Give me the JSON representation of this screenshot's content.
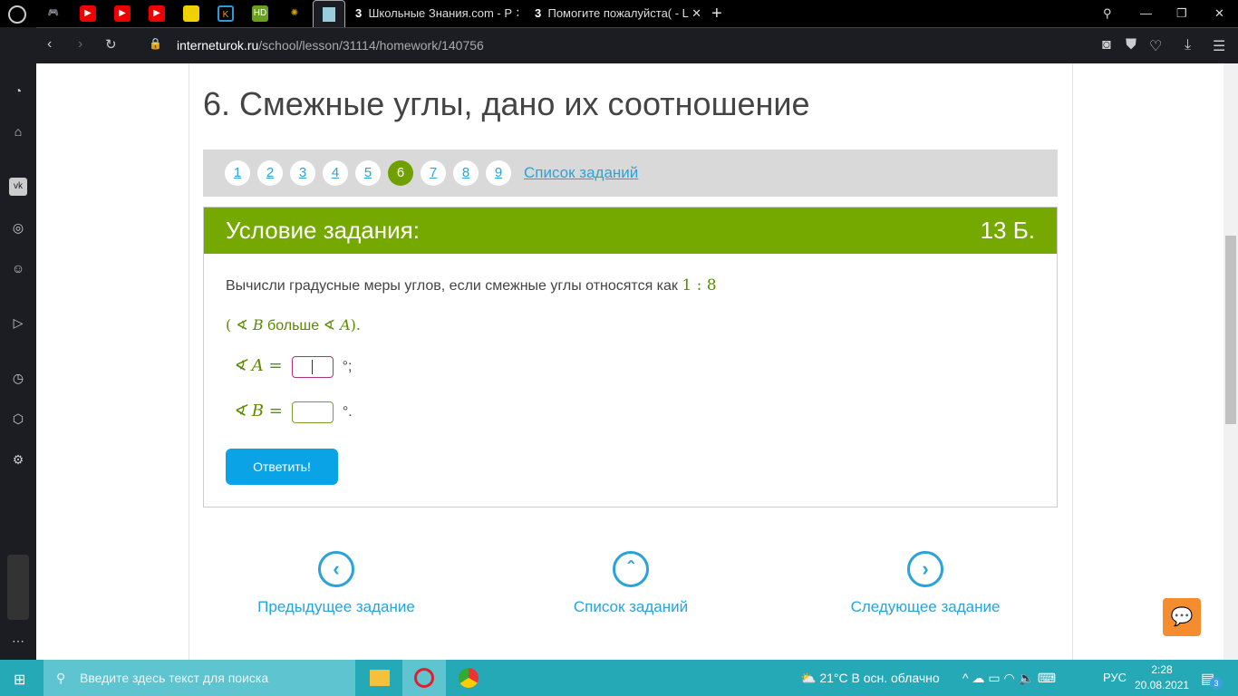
{
  "browser": {
    "tabs": [
      {
        "label": "Школьные Знания.com - Р"
      },
      {
        "label": "Помогите пожалуйста( - L"
      }
    ],
    "url_domain": "interneturok.ru",
    "url_path": "/school/lesson/31114/homework/140756"
  },
  "page": {
    "title": "6. Смежные углы, дано их соотношение",
    "pages": [
      "1",
      "2",
      "3",
      "4",
      "5",
      "6",
      "7",
      "8",
      "9"
    ],
    "active_page": "6",
    "task_list_link": "Список заданий",
    "card": {
      "header": "Условие задания:",
      "points": "13 Б.",
      "question": "Вычисли градусные меры углов, если смежные углы относятся как",
      "ratio": "1 : 8",
      "cond_open": "( ∢ ",
      "cond_B": "B",
      "cond_mid": " больше ",
      "cond_angle": "∢ ",
      "cond_A": "A",
      "cond_close": ").",
      "angle_a_label": "∢ A =",
      "angle_a_suffix": "°;",
      "angle_b_label": "∢ B =",
      "angle_b_suffix": "°.",
      "submit": "Ответить!"
    },
    "nav": {
      "prev": "Предыдущее задание",
      "list": "Список заданий",
      "next": "Следующее задание"
    }
  },
  "taskbar": {
    "search_placeholder": "Введите здесь текст для поиска",
    "weather": "21°C  В осн. облачно",
    "lang": "РУС",
    "time": "2:28",
    "date": "20.08.2021",
    "notifications": "3"
  },
  "colors": {
    "accent_green": "#75a900",
    "link_blue": "#29a3d9",
    "button_blue": "#0aa3e6"
  }
}
